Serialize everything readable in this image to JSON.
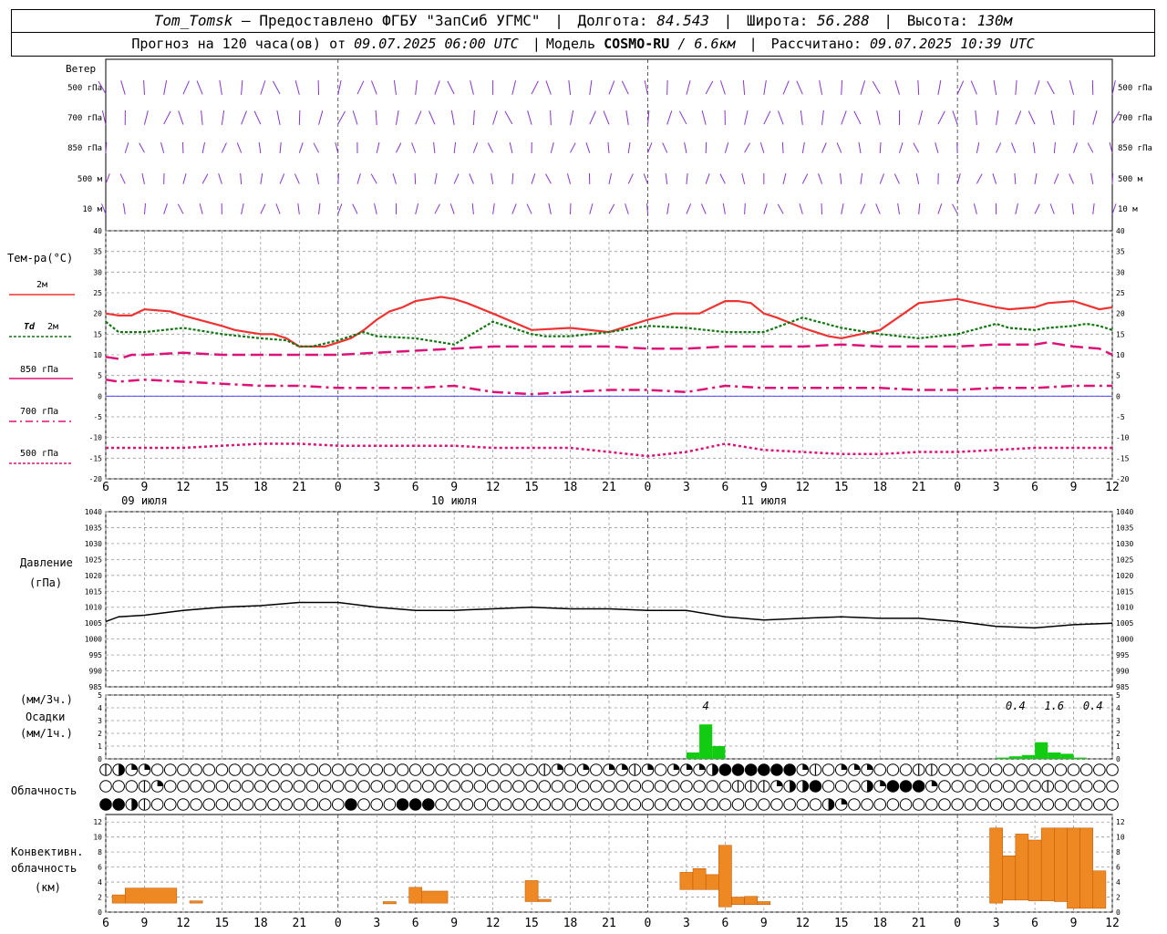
{
  "header": {
    "station": "Tom_Tomsk",
    "dash": "–",
    "provider": "Предоставлено ФГБУ \"ЗапСиб УГМС\"",
    "lon_label": "Долгота:",
    "lon": "84.543",
    "lat_label": "Широта:",
    "lat": "56.288",
    "alt_label": "Высота:",
    "alt": "130м",
    "forecast_prefix": "Прогноз на 120 часа(ов) от",
    "forecast_start": "09.07.2025 06:00 UTC",
    "model_label": "Модель",
    "model": "COSMO-RU",
    "resolution": "/ 6.6км",
    "calc_label": "Рассчитано:",
    "calc_time": "09.07.2025 10:39 UTC"
  },
  "labels": {
    "wind": "Ветер",
    "wind_levels": [
      "500 гПа",
      "700 гПа",
      "850 гПа",
      "500 м",
      "10 м"
    ],
    "temp": "Тем-ра(°C)",
    "leg_2m": "2м",
    "leg_td": "Td",
    "leg_td2": "2м",
    "leg_850": "850 гПа",
    "leg_700": "700 гПа",
    "leg_500": "500 гПа",
    "pressure": "Давление",
    "pressure_unit": "(гПа)",
    "precip_unit1": "(мм/3ч.)",
    "precip": "Осадки",
    "precip_unit2": "(мм/1ч.)",
    "cloud": "Облачность",
    "conv1": "Конвективн.",
    "conv2": "облачность",
    "conv3": "(км)"
  },
  "colors": {
    "t2m": "#ee3333",
    "td": "#117711",
    "levels": "#dd1177",
    "wind": "#8833cc",
    "precip": "#11cc11",
    "conv": "#ee8822",
    "grid": "#999999",
    "zero": "#3333ff"
  },
  "chart_data": [
    {
      "type": "line",
      "name": "wind",
      "levels": [
        "500 гПа",
        "700 гПа",
        "850 гПа",
        "500 м",
        "10 м"
      ]
    },
    {
      "type": "line",
      "x_hours": [
        0,
        3,
        6,
        9,
        12,
        15,
        18,
        21,
        24,
        27,
        30,
        33,
        36,
        39,
        42,
        45,
        48,
        51,
        54,
        57,
        60,
        63,
        66,
        69,
        72,
        75,
        78
      ],
      "x_tick_labels": [
        "6",
        "9",
        "12",
        "15",
        "18",
        "21",
        "0",
        "3",
        "6",
        "9",
        "12",
        "15",
        "18",
        "21",
        "0",
        "3",
        "6",
        "9",
        "12",
        "15",
        "18",
        "21",
        "0",
        "3",
        "6",
        "9",
        "12"
      ],
      "date_labels": [
        {
          "hour": 3,
          "text": "09 июля"
        },
        {
          "hour": 27,
          "text": "10 июля"
        },
        {
          "hour": 51,
          "text": "11 июля"
        }
      ],
      "ylim": [
        -20,
        40
      ],
      "yticks": [
        40,
        35,
        30,
        25,
        20,
        15,
        10,
        5,
        0,
        -5,
        -10,
        -15,
        -20
      ],
      "series": [
        {
          "name": "2м",
          "x": [
            0,
            1,
            2,
            3,
            5,
            6,
            9,
            10,
            12,
            13,
            14,
            15,
            16,
            17,
            18,
            19,
            20,
            21,
            22,
            23,
            24,
            26,
            27,
            28,
            30,
            33,
            36,
            39,
            42,
            44,
            46,
            47,
            48,
            49,
            50,
            51,
            52,
            54,
            56,
            57,
            60,
            63,
            66,
            69,
            70,
            72,
            73,
            75,
            76,
            77,
            78
          ],
          "y": [
            20,
            19.5,
            19.5,
            21,
            20.5,
            19.5,
            17,
            16,
            15,
            15,
            14,
            12,
            12,
            12,
            13,
            14,
            16,
            18.5,
            20.5,
            21.5,
            23,
            24,
            23.5,
            22.5,
            20,
            16,
            16.5,
            15.5,
            18.5,
            20,
            20,
            21.5,
            23,
            23,
            22.5,
            20,
            19,
            16.5,
            14.5,
            14,
            16,
            22.5,
            23.5,
            21.5,
            21,
            21.5,
            22.5,
            23,
            22,
            21,
            21.5
          ]
        },
        {
          "name": "Td 2м",
          "x": [
            0,
            1,
            3,
            6,
            9,
            12,
            14,
            15,
            16,
            18,
            20,
            21,
            24,
            27,
            30,
            33,
            34,
            36,
            39,
            42,
            45,
            48,
            51,
            54,
            57,
            60,
            63,
            66,
            69,
            70,
            72,
            73,
            75,
            76,
            77,
            78
          ],
          "y": [
            18,
            15.5,
            15.5,
            16.5,
            15,
            14,
            13.5,
            12,
            12,
            13.5,
            15.5,
            14.5,
            14,
            12.5,
            18,
            15,
            14.5,
            14.5,
            15.5,
            17,
            16.5,
            15.5,
            15.5,
            19,
            16.5,
            15,
            14,
            15,
            17.5,
            16.5,
            16,
            16.5,
            17,
            17.5,
            17,
            16
          ]
        },
        {
          "name": "850 гПа",
          "x": [
            0,
            1,
            2,
            3,
            6,
            9,
            12,
            15,
            18,
            21,
            24,
            27,
            30,
            33,
            36,
            39,
            42,
            45,
            48,
            51,
            54,
            57,
            60,
            63,
            66,
            69,
            72,
            73,
            75,
            77,
            78
          ],
          "y": [
            9.5,
            9,
            10,
            10,
            10.5,
            10,
            10,
            10,
            10,
            10.5,
            11,
            11.5,
            12,
            12,
            12,
            12,
            11.5,
            11.5,
            12,
            12,
            12,
            12.5,
            12,
            12,
            12,
            12.5,
            12.5,
            13,
            12,
            11.5,
            10
          ]
        },
        {
          "name": "700 гПа",
          "x": [
            0,
            1,
            3,
            6,
            9,
            12,
            15,
            18,
            21,
            24,
            27,
            30,
            33,
            36,
            39,
            42,
            45,
            48,
            51,
            54,
            57,
            60,
            63,
            66,
            69,
            72,
            75,
            78
          ],
          "y": [
            4,
            3.5,
            4,
            3.5,
            3,
            2.5,
            2.5,
            2,
            2,
            2,
            2.5,
            1,
            0.5,
            1,
            1.5,
            1.5,
            1,
            2.5,
            2,
            2,
            2,
            2,
            1.5,
            1.5,
            2,
            2,
            2.5,
            2.5
          ]
        },
        {
          "name": "500 гПа",
          "x": [
            0,
            3,
            6,
            9,
            12,
            15,
            18,
            21,
            24,
            27,
            30,
            33,
            36,
            39,
            42,
            45,
            48,
            51,
            54,
            57,
            60,
            63,
            66,
            69,
            72,
            75,
            78
          ],
          "y": [
            -12.5,
            -12.5,
            -12.5,
            -12,
            -11.5,
            -11.5,
            -12,
            -12,
            -12,
            -12,
            -12.5,
            -12.5,
            -12.5,
            -13.5,
            -14.5,
            -13.5,
            -11.5,
            -13,
            -13.5,
            -14,
            -14,
            -13.5,
            -13.5,
            -13,
            -12.5,
            -12.5,
            -12.5
          ]
        }
      ]
    },
    {
      "type": "line",
      "name": "pressure",
      "ylim": [
        985,
        1040
      ],
      "yticks": [
        1040,
        1035,
        1030,
        1025,
        1020,
        1015,
        1010,
        1005,
        1000,
        995,
        990,
        985
      ],
      "x": [
        0,
        1,
        3,
        6,
        9,
        12,
        15,
        18,
        21,
        24,
        27,
        30,
        33,
        36,
        39,
        42,
        45,
        48,
        51,
        54,
        57,
        60,
        63,
        66,
        69,
        72,
        75,
        78
      ],
      "y": [
        1005.5,
        1007,
        1007.5,
        1009,
        1010,
        1010.5,
        1011.5,
        1011.5,
        1010,
        1009,
        1009,
        1009.5,
        1010,
        1009.5,
        1009.5,
        1009,
        1009,
        1007,
        1006,
        1006.5,
        1007,
        1006.5,
        1006.5,
        1005.5,
        1004,
        1003.5,
        1004.5,
        1005
      ]
    },
    {
      "type": "bar",
      "name": "precip",
      "ylim": [
        0,
        5
      ],
      "yticks": [
        5,
        4,
        3,
        2,
        1,
        0
      ],
      "annotations": [
        {
          "hour": 46.5,
          "text": "4"
        },
        {
          "hour": 70.5,
          "text": "0.4"
        },
        {
          "hour": 73.5,
          "text": "1.6"
        },
        {
          "hour": 76.5,
          "text": "0.4"
        }
      ],
      "bars": [
        {
          "hour": 45.5,
          "value": 0.5
        },
        {
          "hour": 46.5,
          "value": 2.7
        },
        {
          "hour": 47.5,
          "value": 1
        },
        {
          "hour": 69.5,
          "value": 0.1
        },
        {
          "hour": 70.5,
          "value": 0.2
        },
        {
          "hour": 71.5,
          "value": 0.3
        },
        {
          "hour": 72.5,
          "value": 1.3
        },
        {
          "hour": 73.5,
          "value": 0.5
        },
        {
          "hour": 74.5,
          "value": 0.4
        },
        {
          "hour": 75.5,
          "value": 0.1
        }
      ]
    },
    {
      "type": "table",
      "name": "cloud",
      "rows": [
        "13220000000000000000000000000000001202022120222344444421022200011000000000000002022122223444200210",
        "00012000000000000000000000000000000000000000000001112334000324442000000001000000000000000002100342100",
        "44310000000000000004000444000000000000000000000000000000320000000000000000000004000000000000004002411244"
      ]
    },
    {
      "type": "bar",
      "name": "conv",
      "ylim": [
        0,
        13
      ],
      "yticks": [
        12,
        10,
        8,
        6,
        4,
        2,
        0
      ],
      "bars": [
        {
          "hour0": 0.5,
          "hour1": 1.5,
          "bottom": 1.2,
          "top": 2.3
        },
        {
          "hour0": 1.5,
          "hour1": 5.5,
          "bottom": 1.2,
          "top": 3.2
        },
        {
          "hour0": 6.5,
          "hour1": 7.5,
          "bottom": 1.2,
          "top": 1.5
        },
        {
          "hour0": 21.5,
          "hour1": 22.5,
          "bottom": 1.1,
          "top": 1.4
        },
        {
          "hour0": 23.5,
          "hour1": 24.5,
          "bottom": 1.2,
          "top": 3.3
        },
        {
          "hour0": 24.5,
          "hour1": 26.5,
          "bottom": 1.2,
          "top": 2.8
        },
        {
          "hour0": 32.5,
          "hour1": 33.5,
          "bottom": 1.4,
          "top": 4.2
        },
        {
          "hour0": 33.5,
          "hour1": 34.5,
          "bottom": 1.4,
          "top": 1.7
        },
        {
          "hour0": 44.5,
          "hour1": 45.5,
          "bottom": 3,
          "top": 5.3
        },
        {
          "hour0": 45.5,
          "hour1": 46.5,
          "bottom": 3,
          "top": 5.8
        },
        {
          "hour0": 46.5,
          "hour1": 47.5,
          "bottom": 3,
          "top": 5
        },
        {
          "hour0": 47.5,
          "hour1": 48.5,
          "bottom": 0.7,
          "top": 8.9
        },
        {
          "hour0": 48.5,
          "hour1": 49.5,
          "bottom": 1,
          "top": 2
        },
        {
          "hour0": 49.5,
          "hour1": 50.5,
          "bottom": 1,
          "top": 2.1
        },
        {
          "hour0": 50.5,
          "hour1": 51.5,
          "bottom": 1,
          "top": 1.4
        },
        {
          "hour0": 68.5,
          "hour1": 69.5,
          "bottom": 1.2,
          "top": 11.2
        },
        {
          "hour0": 69.5,
          "hour1": 70.5,
          "bottom": 1.6,
          "top": 7.5
        },
        {
          "hour0": 70.5,
          "hour1": 71.5,
          "bottom": 1.6,
          "top": 10.4
        },
        {
          "hour0": 71.5,
          "hour1": 72.5,
          "bottom": 1.5,
          "top": 9.6
        },
        {
          "hour0": 72.5,
          "hour1": 73.5,
          "bottom": 1.5,
          "top": 11.2
        },
        {
          "hour0": 73.5,
          "hour1": 74.5,
          "bottom": 1.4,
          "top": 11.2
        },
        {
          "hour0": 74.5,
          "hour1": 75.5,
          "bottom": 0.5,
          "top": 11.2
        },
        {
          "hour0": 75.5,
          "hour1": 76.5,
          "bottom": 0.5,
          "top": 11.2
        },
        {
          "hour0": 76.5,
          "hour1": 77.5,
          "bottom": 0.5,
          "top": 5.5
        }
      ]
    }
  ]
}
